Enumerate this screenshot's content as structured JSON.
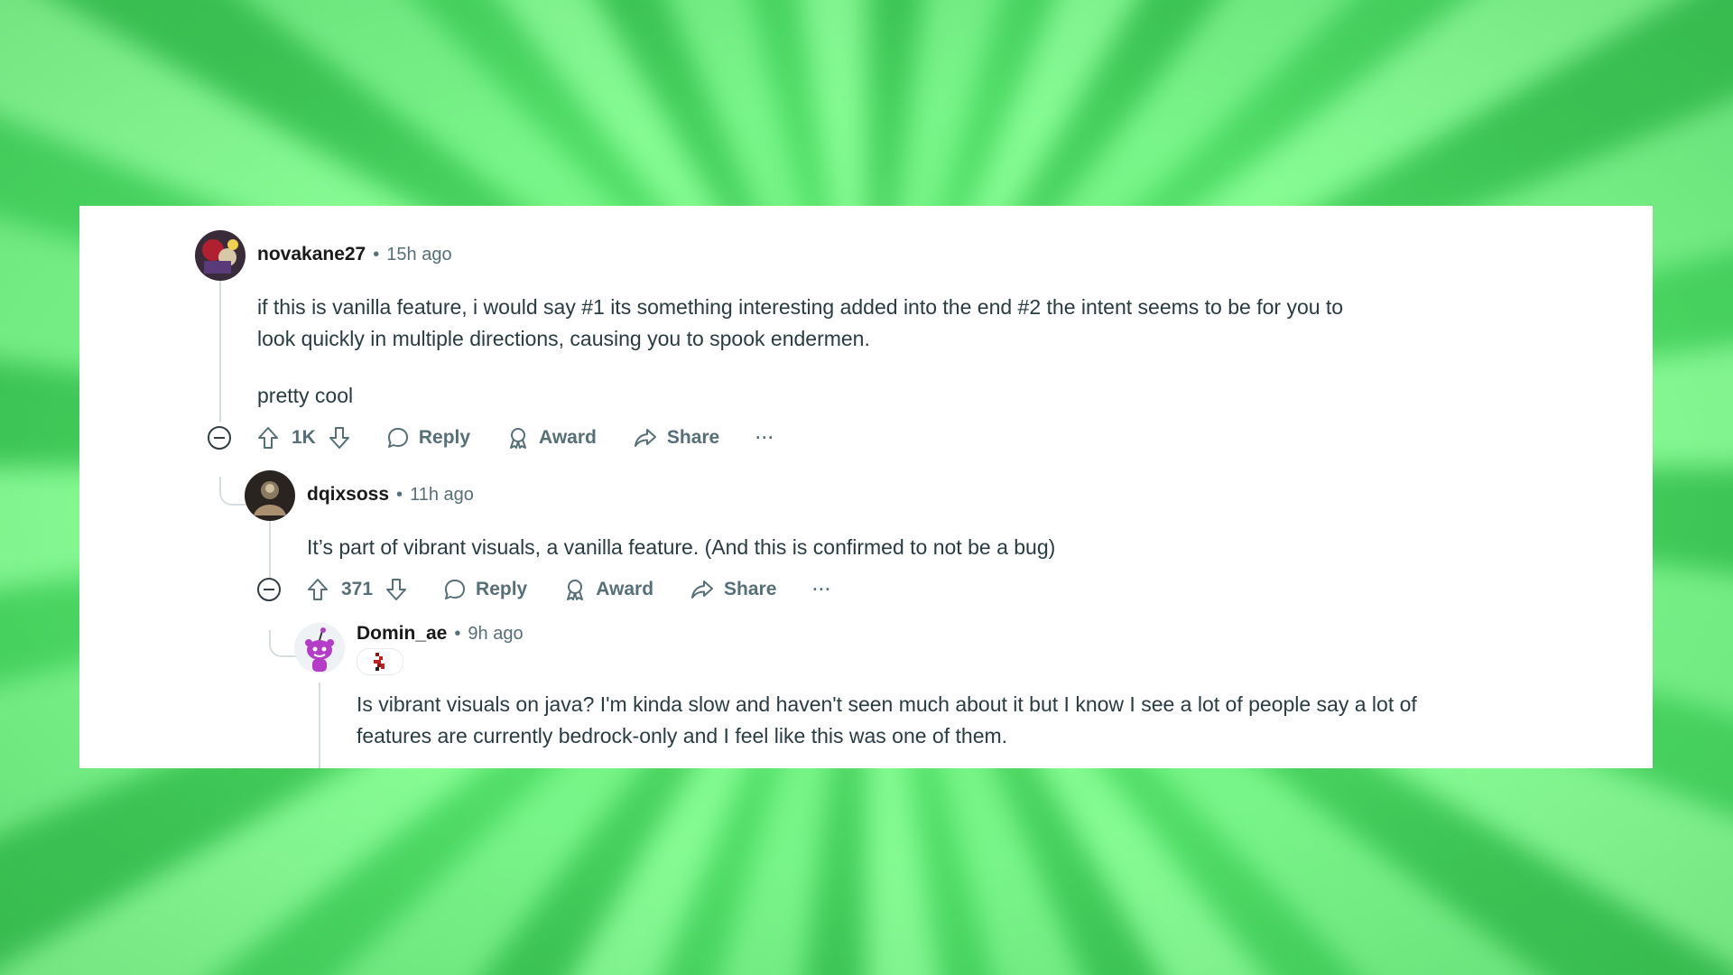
{
  "comments": [
    {
      "username": "novakane27",
      "time": "15h ago",
      "body_lines": [
        "if this is vanilla feature, i would say #1 its something interesting added into the end #2 the intent seems to be for you to look quickly in multiple directions, causing you to spook endermen."
      ],
      "body_extra": "pretty cool",
      "votes": "1K",
      "reply_label": "Reply",
      "award_label": "Award",
      "share_label": "Share",
      "more_label": "···"
    },
    {
      "username": "dqixsoss",
      "time": "11h ago",
      "body": "It’s part of vibrant visuals, a vanilla feature. (And this is confirmed to not be a bug)",
      "votes": "371",
      "reply_label": "Reply",
      "award_label": "Award",
      "share_label": "Share",
      "more_label": "···"
    },
    {
      "username": "Domin_ae",
      "time": "9h ago",
      "body": "Is vibrant visuals on java? I'm kinda slow and haven't seen much about it but I know I see a lot of people say a lot of features are currently bedrock-only and I feel like this was one of them."
    }
  ],
  "separator": "•",
  "colors": {
    "background": "#4fdf68",
    "card": "#ffffff",
    "username": "#1a1a1b",
    "meta": "#576f76",
    "body": "#2a3c42"
  },
  "icons": [
    "upvote-icon",
    "downvote-icon",
    "comment-icon",
    "award-icon",
    "share-icon",
    "more-icon",
    "collapse-icon"
  ]
}
